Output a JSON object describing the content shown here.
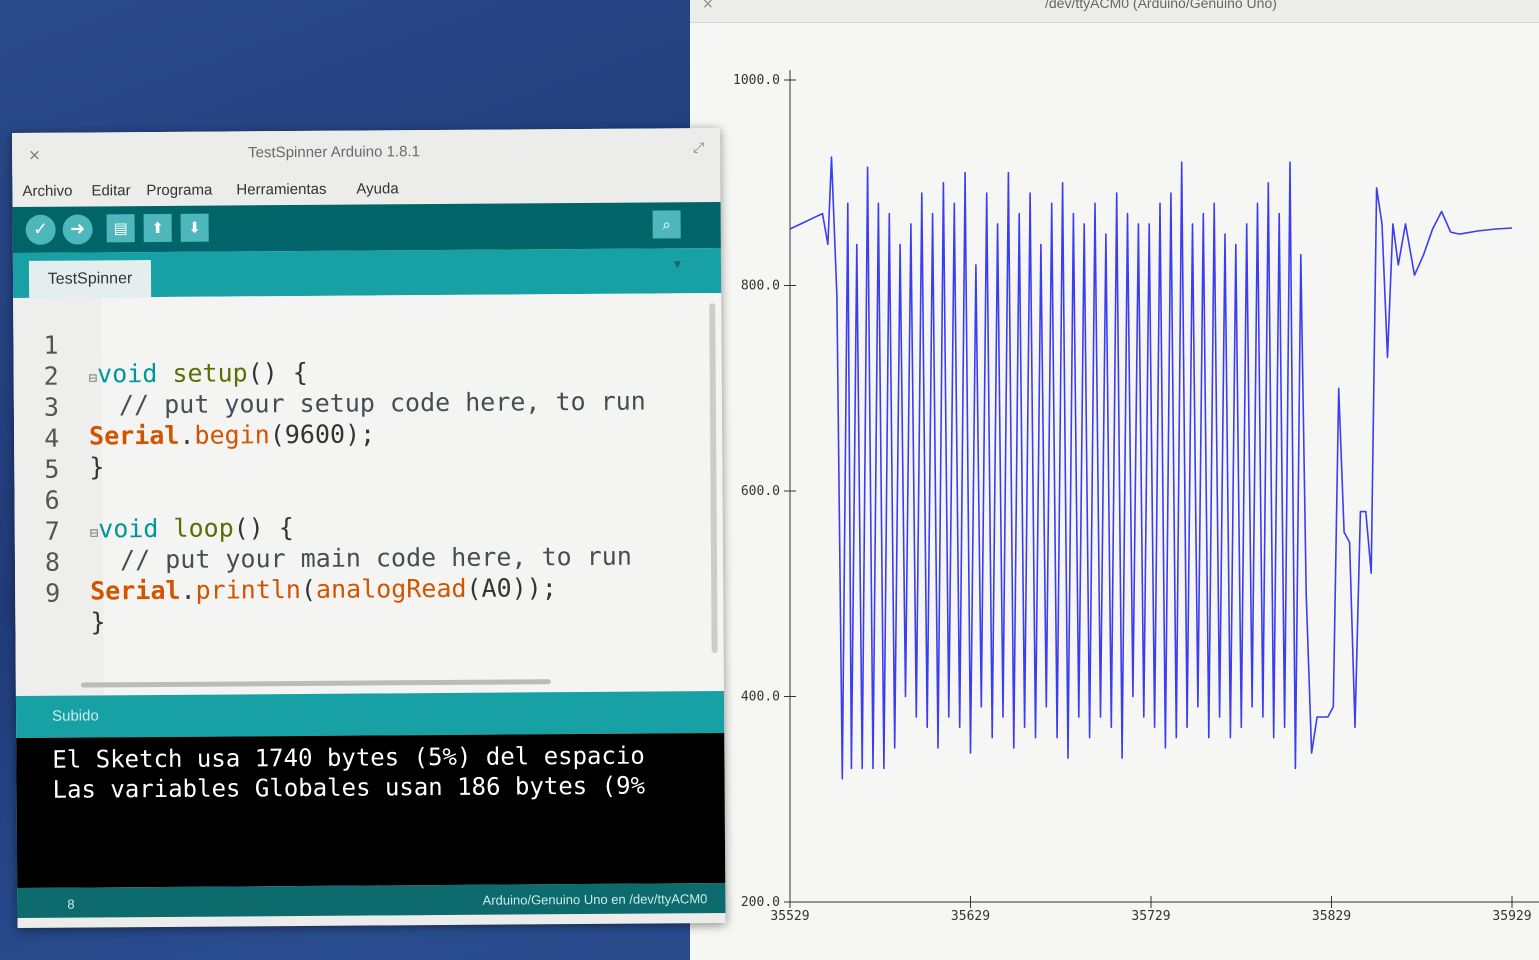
{
  "plotter": {
    "title": "/dev/ttyACM0 (Arduino/Genuino Uno)",
    "close_glyph": "×"
  },
  "chart_data": {
    "type": "line",
    "title": "",
    "xlabel": "",
    "ylabel": "",
    "ylim": [
      200,
      1000
    ],
    "xlim": [
      35529,
      35929
    ],
    "y_ticks": [
      "1000.0",
      "800.0",
      "600.0",
      "400.0",
      "200.0"
    ],
    "y_tick_values": [
      1000,
      800,
      600,
      400,
      200
    ],
    "x_ticks": [
      "35529",
      "35629",
      "35729",
      "35829",
      "35929"
    ],
    "x_tick_values": [
      35529,
      35629,
      35729,
      35829,
      35929
    ],
    "grid": false,
    "series_color": "#3d3df0",
    "series": [
      {
        "x": [
          35529,
          35535,
          35541,
          35547,
          35550,
          35552,
          35555,
          35558,
          35561,
          35563,
          35566,
          35569,
          35572,
          35575,
          35578,
          35581,
          35584,
          35587,
          35590,
          35593,
          35596,
          35599,
          35602,
          35605,
          35608,
          35611,
          35614,
          35617,
          35620,
          35623,
          35626,
          35629,
          35632,
          35635,
          35638,
          35641,
          35644,
          35647,
          35650,
          35653,
          35656,
          35659,
          35662,
          35665,
          35668,
          35671,
          35674,
          35677,
          35680,
          35683,
          35686,
          35689,
          35692,
          35695,
          35698,
          35701,
          35704,
          35707,
          35710,
          35713,
          35716,
          35719,
          35722,
          35725,
          35728,
          35731,
          35734,
          35737,
          35740,
          35743,
          35746,
          35749,
          35752,
          35755,
          35758,
          35761,
          35764,
          35767,
          35770,
          35773,
          35776,
          35779,
          35782,
          35785,
          35788,
          35791,
          35794,
          35797,
          35800,
          35803,
          35806,
          35809,
          35812,
          35815,
          35818,
          35821,
          35824,
          35827,
          35830,
          35833,
          35836,
          35839,
          35842,
          35845,
          35848,
          35851,
          35854,
          35857,
          35860,
          35863,
          35866,
          35870,
          35875,
          35880,
          35885,
          35890,
          35895,
          35900,
          35910,
          35920,
          35929
        ],
        "y": [
          855,
          860,
          865,
          870,
          840,
          925,
          790,
          320,
          880,
          330,
          840,
          330,
          915,
          330,
          880,
          330,
          870,
          350,
          840,
          400,
          860,
          380,
          890,
          370,
          870,
          350,
          900,
          380,
          880,
          370,
          910,
          345,
          820,
          390,
          890,
          360,
          860,
          380,
          910,
          350,
          870,
          370,
          890,
          360,
          840,
          390,
          880,
          360,
          900,
          340,
          870,
          380,
          860,
          360,
          880,
          380,
          850,
          370,
          890,
          340,
          870,
          400,
          860,
          380,
          860,
          370,
          880,
          350,
          890,
          360,
          920,
          370,
          860,
          390,
          870,
          360,
          880,
          380,
          850,
          360,
          840,
          370,
          860,
          390,
          880,
          380,
          900,
          360,
          870,
          370,
          920,
          330,
          830,
          500,
          345,
          380,
          380,
          380,
          390,
          700,
          560,
          550,
          370,
          580,
          580,
          520,
          895,
          860,
          730,
          860,
          820,
          860,
          810,
          830,
          855,
          872,
          852,
          850,
          853,
          855,
          856
        ]
      }
    ]
  },
  "ide": {
    "title": "TestSpinner Arduino 1.8.1",
    "close_glyph": "×",
    "maximize_glyph": "⤢",
    "menu": [
      "Archivo",
      "Editar",
      "Programa",
      "Herramientas",
      "Ayuda"
    ],
    "tab_label": "TestSpinner",
    "tab_menu_glyph": "▾",
    "code_lines": [
      {
        "n": "1",
        "text": "void setup() {"
      },
      {
        "n": "2",
        "text": "  // put your setup code here, to run"
      },
      {
        "n": "3",
        "text": "Serial.begin(9600);"
      },
      {
        "n": "4",
        "text": "}"
      },
      {
        "n": "5",
        "text": ""
      },
      {
        "n": "6",
        "text": "void loop() {"
      },
      {
        "n": "7",
        "text": "  // put your main code here, to run"
      },
      {
        "n": "8",
        "text": "Serial.println(analogRead(A0));"
      },
      {
        "n": "9",
        "text": "}"
      }
    ],
    "console_status": "Subido",
    "console_lines": [
      "El Sketch usa 1740 bytes (5%) del espacio",
      "Las variables Globales usan 186 bytes (9%"
    ],
    "status_line": "8",
    "status_board": "Arduino/Genuino Uno en /dev/ttyACM0"
  }
}
